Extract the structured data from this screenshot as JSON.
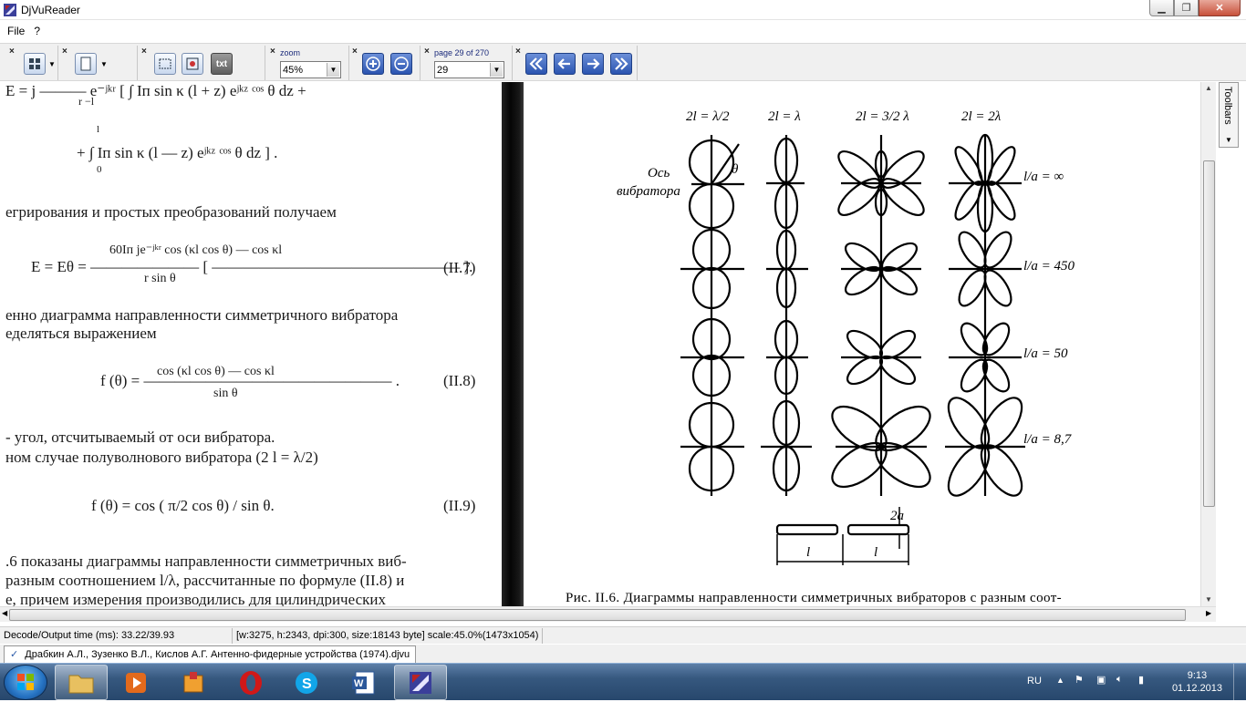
{
  "window": {
    "title": "DjVuReader",
    "minimize": "▁",
    "maximize": "❐",
    "close": "✕"
  },
  "menu": {
    "file": "File",
    "help": "?"
  },
  "toolbar": {
    "zoom_label": "zoom",
    "zoom_value": "45%",
    "page_label": "page 29 of 270",
    "page_value": "29",
    "text_button": "txt"
  },
  "toolbars_panel": "Toolbars",
  "left_page": {
    "lines": [
      "E = j ——— e⁻ʲᵏʳ  [ ∫ Iп sin κ (l + z) eʲᵏᶻ ᶜᵒˢ θ dz +",
      "r               −l",
      "l",
      "+ ∫ Iп sin κ (l — z) eʲᵏᶻ ᶜᵒˢ θ dz ] .",
      "0",
      "егрирования и простых преобразований получаем",
      "60Iп je⁻ʲᵏʳ    cos (κl cos θ) — cos κl",
      "E = Eθ = ——————— [ ———————————————— ].",
      "r                    sin θ",
      "(II.7)",
      "енно диаграмма направленности симметричного вибратора",
      "еделяться выражением",
      "cos (κl cos θ) — cos κl",
      "f (θ) = ———————————————— .",
      "sin θ",
      "(II.8)",
      "- угол, отсчитываемый от оси вибратора.",
      "ном случае полуволнового вибратора (2 l = λ/2)",
      "f (θ) = cos ( π/2 cos θ) / sin θ.",
      "(II.9)",
      ".6 показаны диаграммы направленности симметричных виб-",
      "разным соотношением l/λ, рассчитанные по формуле (II.8) и",
      "е, причем измерения производились для цилиндрических"
    ]
  },
  "figure": {
    "column_headers": [
      "2l = λ/2",
      "2l = λ",
      "2l = 3/2 λ",
      "2l = 2λ"
    ],
    "axis_label_line1": "Ось",
    "axis_label_line2": "вибратора",
    "theta": "θ",
    "row_labels": [
      "l/a = ∞",
      "l/a = 450",
      "l/a = 50",
      "l/a = 8,7"
    ],
    "dim_2a": "2a",
    "dim_l1": "l",
    "dim_l2": "l",
    "caption": "Рис. II.6. Диаграммы направленности симметричных вибраторов с разным соот-"
  },
  "status": {
    "decode_time": "Decode/Output time (ms): 33.22/39.93",
    "info": "[w:3275, h:2343, dpi:300, size:18143 byte] scale:45.0%(1473x1054)"
  },
  "document_tab": "Драбкин А.Л., Зузенко В.Л., Кислов А.Г. Антенно-фидерные устройства (1974).djvu",
  "taskbar": {
    "lang": "RU",
    "time": "9:13",
    "date": "01.12.2013"
  }
}
